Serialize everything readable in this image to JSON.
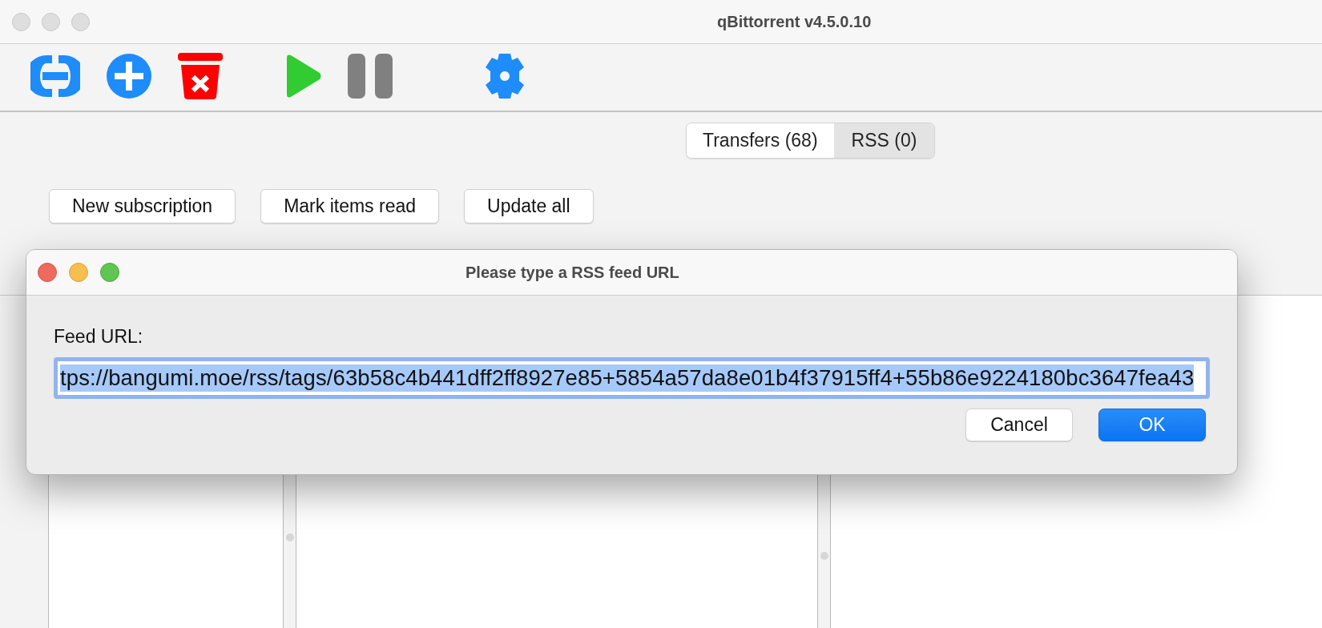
{
  "window": {
    "title": "qBittorrent v4.5.0.10"
  },
  "toolbar": [
    {
      "kind": "link"
    },
    {
      "kind": "add"
    },
    {
      "kind": "delete"
    },
    {
      "kind": "resume"
    },
    {
      "kind": "pause"
    },
    {
      "kind": "settings"
    }
  ],
  "tabs": [
    {
      "label": "Transfers (68)",
      "selected": false
    },
    {
      "label": "RSS (0)",
      "selected": true
    }
  ],
  "rss_buttons": [
    "New subscription",
    "Mark items read",
    "Update all"
  ],
  "dialog": {
    "title": "Please type a RSS feed URL",
    "label": "Feed URL:",
    "url_field": {
      "value": "tps://bangumi.moe/rss/tags/63b58c4b441dff2ff8927e85+5854a57da8e01b4f37915ff4+55b86e9224180bc3647fea43",
      "selected": true
    },
    "buttons": [
      {
        "label": "Cancel",
        "default": false
      },
      {
        "label": "OK",
        "default": true
      }
    ]
  }
}
